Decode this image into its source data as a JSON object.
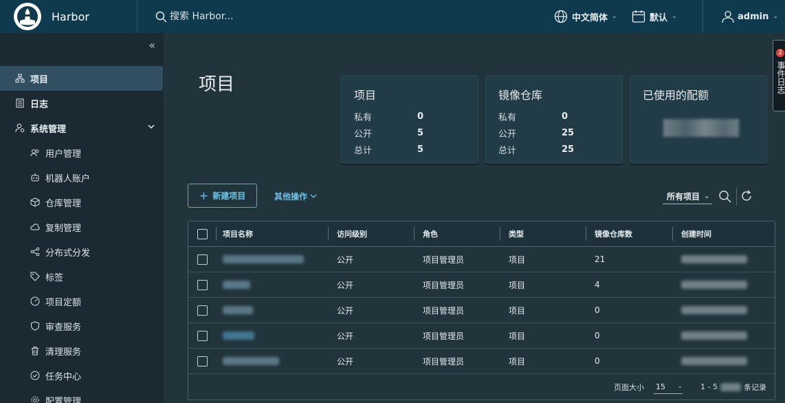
{
  "header": {
    "brand": "Harbor",
    "search_placeholder": "搜索 Harbor...",
    "language": "中文简体",
    "theme": "默认",
    "user": "admin"
  },
  "sidebar": {
    "items": [
      {
        "label": "项目",
        "icon": "projects-icon",
        "active": true
      },
      {
        "label": "日志",
        "icon": "log-icon"
      },
      {
        "label": "系统管理",
        "icon": "admin-icon",
        "expanded": true
      }
    ],
    "sub_items": [
      {
        "label": "用户管理",
        "icon": "users-icon"
      },
      {
        "label": "机器人账户",
        "icon": "robot-icon"
      },
      {
        "label": "仓库管理",
        "icon": "box-icon"
      },
      {
        "label": "复制管理",
        "icon": "cloud-sync-icon"
      },
      {
        "label": "分布式分发",
        "icon": "share-icon"
      },
      {
        "label": "标签",
        "icon": "tag-icon"
      },
      {
        "label": "项目定额",
        "icon": "dashboard-icon"
      },
      {
        "label": "审查服务",
        "icon": "shield-icon"
      },
      {
        "label": "清理服务",
        "icon": "trash-icon"
      },
      {
        "label": "任务中心",
        "icon": "task-icon"
      },
      {
        "label": "配置管理",
        "icon": "gear-icon"
      }
    ]
  },
  "main": {
    "title": "项目",
    "cards": {
      "projects": {
        "title": "项目",
        "private_label": "私有",
        "private": "0",
        "public_label": "公开",
        "public": "5",
        "total_label": "总计",
        "total": "5"
      },
      "repos": {
        "title": "镜像仓库",
        "private_label": "私有",
        "private": "0",
        "public_label": "公开",
        "public": "25",
        "total_label": "总计",
        "total": "25"
      },
      "quota": {
        "title": "已使用的配额"
      }
    },
    "new_project": "新建项目",
    "more_actions": "其他操作",
    "filter": "所有项目",
    "table": {
      "columns": [
        "项目名称",
        "访问级别",
        "角色",
        "类型",
        "镜像仓库数",
        "创建时间"
      ],
      "rows": [
        {
          "access": "公开",
          "role": "项目管理员",
          "type": "项目",
          "repos": "21"
        },
        {
          "access": "公开",
          "role": "项目管理员",
          "type": "项目",
          "repos": "4"
        },
        {
          "access": "公开",
          "role": "项目管理员",
          "type": "项目",
          "repos": "0"
        },
        {
          "access": "公开",
          "role": "项目管理员",
          "type": "项目",
          "repos": "0"
        },
        {
          "access": "公开",
          "role": "项目管理员",
          "type": "项目",
          "repos": "0"
        }
      ],
      "page_size_label": "页面大小",
      "page_size": "15",
      "range": "1 - 5",
      "records_suffix": "条记录"
    }
  },
  "event_tab": {
    "label": "事件日志",
    "count": "2"
  },
  "colors": {
    "header": "#0f3a4d",
    "sidebar": "#1b2a32",
    "main": "#21333b",
    "accent": "#4aaed9",
    "badge": "#e0423b"
  }
}
